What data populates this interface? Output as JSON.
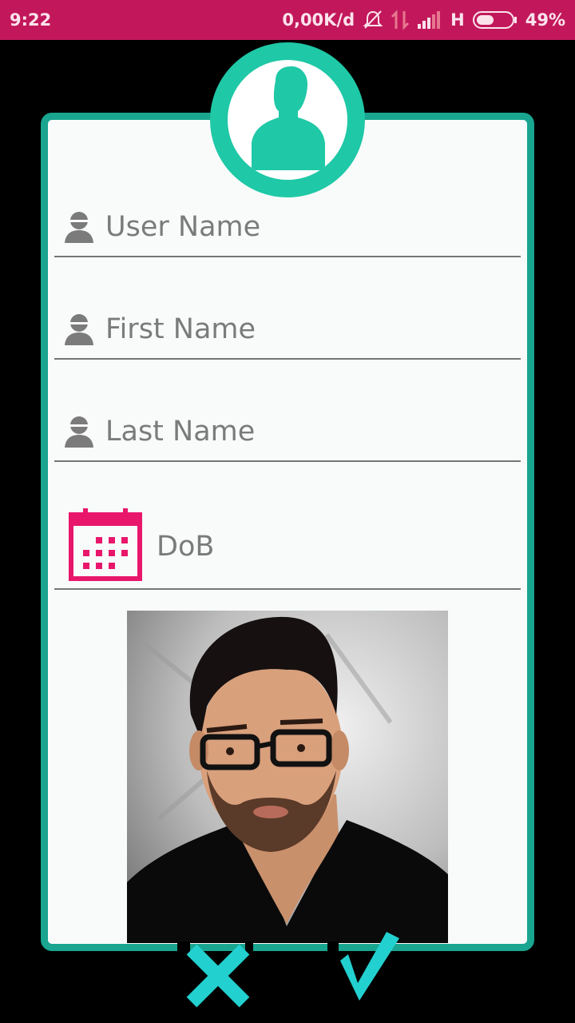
{
  "status_bar": {
    "time": "9:22",
    "network_speed": "0,00K/d",
    "network_type": "H",
    "battery": "49%",
    "battery_level": 0.49,
    "icons": [
      "muted-bell-icon",
      "data-transfer-icon",
      "signal-icon",
      "battery-icon"
    ]
  },
  "form": {
    "header_icon": "user-avatar-icon",
    "fields": [
      {
        "icon": "person-icon",
        "placeholder": "User Name"
      },
      {
        "icon": "person-icon",
        "placeholder": "First Name"
      },
      {
        "icon": "person-icon",
        "placeholder": "Last Name"
      },
      {
        "icon": "calendar-icon",
        "placeholder": "DoB"
      }
    ],
    "photo": "profile-photo"
  },
  "actions": {
    "cancel_icon": "close-icon",
    "confirm_icon": "check-icon"
  },
  "colors": {
    "status_bar": "#c2185b",
    "accent_teal": "#19a58f",
    "avatar_teal": "#1fc8a6",
    "calendar_pink": "#e8176b",
    "action_cyan": "#22d0cf"
  }
}
